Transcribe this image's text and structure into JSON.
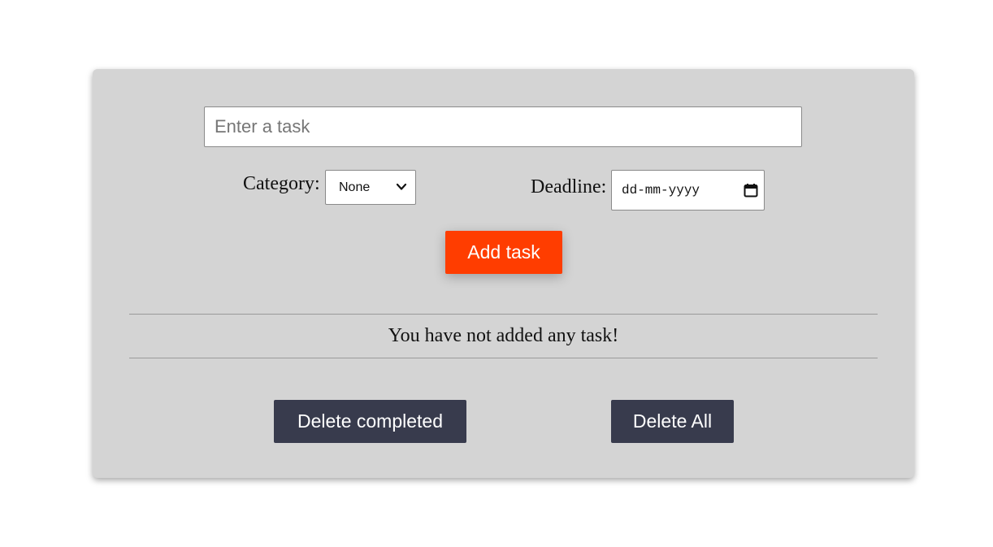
{
  "form": {
    "task_placeholder": "Enter a task",
    "task_value": "",
    "category_label": "Category:",
    "category_selected": "None",
    "deadline_label": "Deadline:",
    "deadline_placeholder": "dd-mm-yyyy",
    "add_button_label": "Add task"
  },
  "tasks": {
    "empty_message": "You have not added any task!",
    "items": []
  },
  "actions": {
    "delete_completed_label": "Delete completed",
    "delete_all_label": "Delete All"
  },
  "colors": {
    "card_background": "#d4d4d4",
    "add_button": "#ff3d00",
    "action_buttons": "#383b4d"
  },
  "icons": {
    "category_dropdown": "chevron-down-icon",
    "deadline_picker": "calendar-icon"
  }
}
